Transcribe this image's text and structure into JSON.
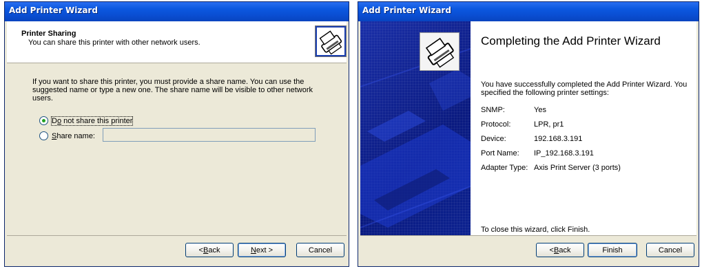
{
  "wizard1": {
    "title": "Add Printer Wizard",
    "header": {
      "title": "Printer Sharing",
      "subtitle": "You can share this printer with other network users.",
      "icon": "printer-icon"
    },
    "instructions": "If you want to share this printer, you must provide a share name. You can use the suggested name or type a new one. The share name will be visible to other network users.",
    "options": {
      "do_not_share": {
        "label": "Do not share this printer",
        "selected": true
      },
      "share_name": {
        "label": "Share name:",
        "selected": false,
        "value": ""
      }
    },
    "buttons": {
      "back": "< Back",
      "next": "Next >",
      "cancel": "Cancel"
    }
  },
  "wizard2": {
    "title": "Add Printer Wizard",
    "heading": "Completing the Add Printer Wizard",
    "summary": "You have successfully completed the Add Printer Wizard. You specified the following printer settings:",
    "settings": [
      {
        "label": "SNMP:",
        "value": "Yes"
      },
      {
        "label": "Protocol:",
        "value": "LPR, pr1"
      },
      {
        "label": "Device:",
        "value": "192.168.3.191"
      },
      {
        "label": "Port Name:",
        "value": "IP_192.168.3.191"
      },
      {
        "label": "Adapter Type:",
        "value": "Axis Print Server (3 ports)"
      }
    ],
    "closing": "To close this wizard, click Finish.",
    "buttons": {
      "back": "< Back",
      "finish": "Finish",
      "cancel": "Cancel"
    }
  },
  "colors": {
    "title_bar": "#0a4fd4",
    "dialog_face": "#ece9d8",
    "banner_blue": "#0a1a80"
  }
}
